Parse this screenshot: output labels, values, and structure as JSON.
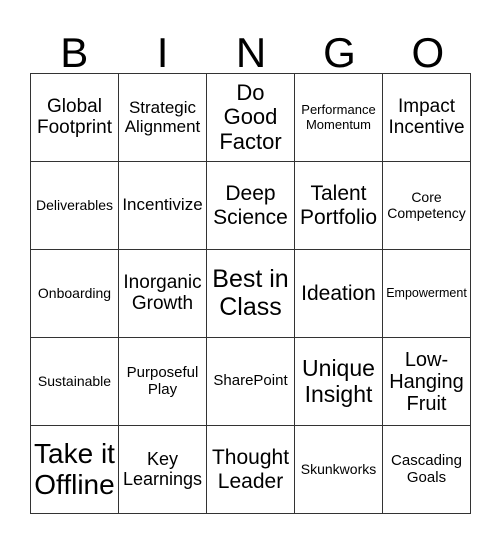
{
  "header": [
    "B",
    "I",
    "N",
    "G",
    "O"
  ],
  "cells": [
    [
      "Global\nFootprint",
      "Strategic\nAlignment",
      "Do\nGood\nFactor",
      "Performance\nMomentum",
      "Impact\nIncentive"
    ],
    [
      "Deliverables",
      "Incentivize",
      "Deep\nScience",
      "Talent\nPortfolio",
      "Core\nCompetency"
    ],
    [
      "Onboarding",
      "Inorganic\nGrowth",
      "Best in\nClass",
      "Ideation",
      "Empowerment"
    ],
    [
      "Sustainable",
      "Purposeful\nPlay",
      "SharePoint",
      "Unique\nInsight",
      "Low-\nHanging\nFruit"
    ],
    [
      "Take it\nOffline",
      "Key\nLearnings",
      "Thought\nLeader",
      "Skunkworks",
      "Cascading\nGoals"
    ]
  ]
}
